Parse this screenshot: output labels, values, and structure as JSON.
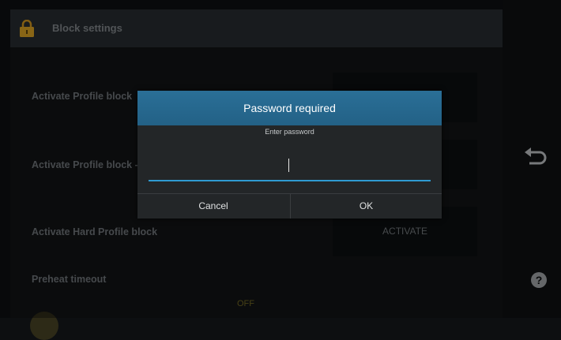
{
  "header": {
    "title": "Block settings"
  },
  "rows": [
    {
      "label": "Activate Profile block"
    },
    {
      "label": "Activate Profile block -"
    },
    {
      "label": "Activate Hard Profile block",
      "button": "ACTIVATE"
    }
  ],
  "preheat": {
    "label": "Preheat timeout",
    "value": "OFF"
  },
  "dialog": {
    "title": "Password required",
    "subtitle": "Enter password",
    "password_value": "",
    "cancel_label": "Cancel",
    "ok_label": "OK"
  },
  "rail": {
    "back_icon": "back-arrow-icon",
    "help_icon": "help-icon",
    "help_glyph": "?"
  },
  "colors": {
    "accent": "#2f9bd2",
    "dialog_header": "#266a91",
    "background": "#111315"
  }
}
